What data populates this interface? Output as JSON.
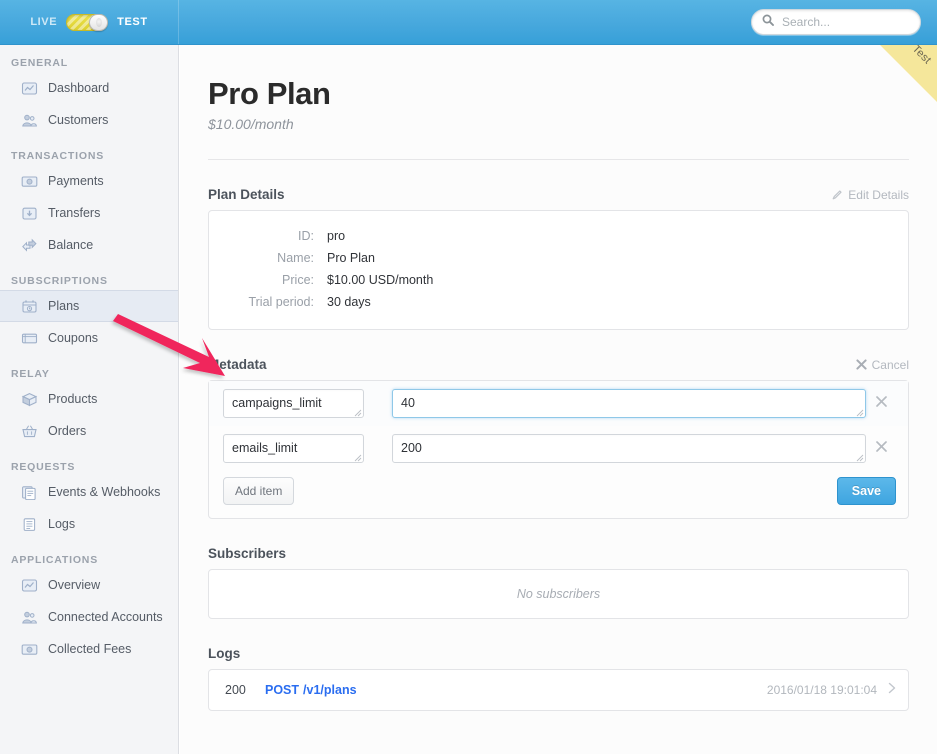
{
  "topbar": {
    "mode_live_label": "LIVE",
    "mode_test_label": "TEST",
    "mode_active": "TEST",
    "search_placeholder": "Search...",
    "search_value": "",
    "search_icon": "search-icon",
    "bar_color": "#47a8dd"
  },
  "ribbon": {
    "label": "Test",
    "color": "#f5e79b"
  },
  "sidebar": {
    "sections": [
      {
        "title": "GENERAL",
        "items": [
          {
            "label": "Dashboard",
            "icon": "chart-monitor-icon",
            "active": false
          },
          {
            "label": "Customers",
            "icon": "people-icon",
            "active": false
          }
        ]
      },
      {
        "title": "TRANSACTIONS",
        "items": [
          {
            "label": "Payments",
            "icon": "banknote-icon",
            "active": false
          },
          {
            "label": "Transfers",
            "icon": "download-box-icon",
            "active": false
          },
          {
            "label": "Balance",
            "icon": "exchange-arrows-icon",
            "active": false
          }
        ]
      },
      {
        "title": "SUBSCRIPTIONS",
        "items": [
          {
            "label": "Plans",
            "icon": "calendar-clock-icon",
            "active": true
          },
          {
            "label": "Coupons",
            "icon": "ticket-icon",
            "active": false
          }
        ]
      },
      {
        "title": "RELAY",
        "items": [
          {
            "label": "Products",
            "icon": "box-icon",
            "active": false
          },
          {
            "label": "Orders",
            "icon": "basket-icon",
            "active": false
          }
        ]
      },
      {
        "title": "REQUESTS",
        "items": [
          {
            "label": "Events & Webhooks",
            "icon": "documents-stack-icon",
            "active": false
          },
          {
            "label": "Logs",
            "icon": "document-lines-icon",
            "active": false
          }
        ]
      },
      {
        "title": "APPLICATIONS",
        "items": [
          {
            "label": "Overview",
            "icon": "chart-monitor-icon",
            "active": false
          },
          {
            "label": "Connected Accounts",
            "icon": "people-icon",
            "active": false
          },
          {
            "label": "Collected Fees",
            "icon": "banknote-icon",
            "active": false
          }
        ]
      }
    ]
  },
  "page": {
    "title": "Pro Plan",
    "subtitle": "$10.00/month"
  },
  "plan_details": {
    "heading": "Plan Details",
    "edit_label": "Edit Details",
    "edit_icon": "pencil-icon",
    "rows": [
      {
        "key": "ID:",
        "value": "pro"
      },
      {
        "key": "Name:",
        "value": "Pro Plan"
      },
      {
        "key": "Price:",
        "value": "$10.00 USD/month"
      },
      {
        "key": "Trial period:",
        "value": "30 days"
      }
    ]
  },
  "metadata": {
    "heading": "Metadata",
    "cancel_label": "Cancel",
    "cancel_icon": "close-x-icon",
    "rows": [
      {
        "key": "campaigns_limit",
        "value": "40",
        "focused": true
      },
      {
        "key": "emails_limit",
        "value": "200",
        "focused": false
      }
    ],
    "add_item_label": "Add item",
    "save_label": "Save",
    "delete_icon": "close-x-icon",
    "focus_border_color": "#8fc8e8",
    "save_color": "#3fa5e0"
  },
  "subscribers": {
    "heading": "Subscribers",
    "empty_text": "No subscribers"
  },
  "logs": {
    "heading": "Logs",
    "rows": [
      {
        "status": "200",
        "method": "POST",
        "path": "/v1/plans",
        "timestamp": "2016/01/18 19:01:04",
        "chevron": "chevron-right-icon"
      }
    ],
    "link_color": "#2a6df0"
  },
  "annotation": {
    "type": "arrow",
    "color": "#f0265c",
    "points_to": "metadata-section"
  }
}
